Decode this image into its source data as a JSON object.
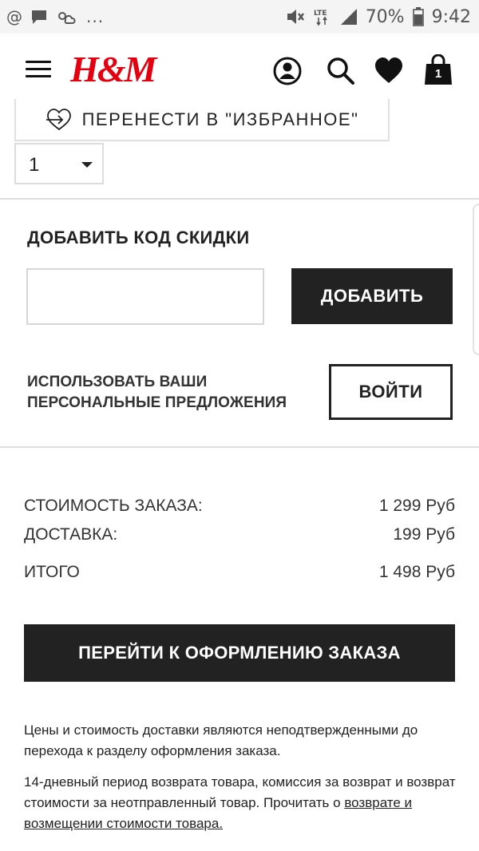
{
  "status_bar": {
    "left_icons": [
      "at-icon",
      "chat-icon",
      "weather-icon"
    ],
    "more": "...",
    "network": "LTE",
    "battery": "70%",
    "time": "9:42"
  },
  "header": {
    "brand": "H&M",
    "bag_count": "1"
  },
  "product": {
    "move_to_favorites": "ПЕРЕНЕСТИ В \"ИЗБРАННОЕ\"",
    "quantity": "1"
  },
  "discount": {
    "title": "ДОБАВИТЬ КОД СКИДКИ",
    "input_value": "",
    "add_label": "ДОБАВИТЬ"
  },
  "offers": {
    "line1": "ИСПОЛЬЗОВАТЬ ВАШИ",
    "line2": "ПЕРСОНАЛЬНЫЕ ПРЕДЛОЖЕНИЯ",
    "login_label": "ВОЙТИ"
  },
  "summary": {
    "rows": [
      {
        "label": "СТОИМОСТЬ ЗАКАЗА:",
        "value": "1 299 Руб"
      },
      {
        "label": "ДОСТАВКА:",
        "value": "199 Руб"
      },
      {
        "label": "ИТОГО",
        "value": "1 498 Руб"
      }
    ],
    "checkout_label": "ПЕРЕЙТИ К ОФОРМЛЕНИЮ ЗАКАЗА"
  },
  "notes": {
    "prices": "Цены и стоимость доставки являются неподтвержденными до перехода к разделу оформления заказа.",
    "returns": "14-дневный период возврата товара, комиссия за возврат и возврат стоимости за неотправленный товар. Прочитать о",
    "returns_link": "возврате и возмещении стоимости товара."
  },
  "colors": {
    "brand": "#e50010",
    "button_dark": "#222222",
    "divider": "#dedede"
  }
}
